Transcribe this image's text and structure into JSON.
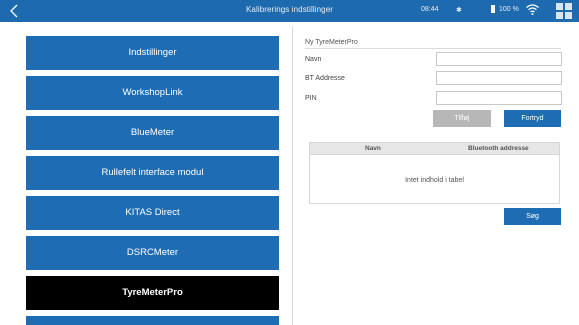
{
  "topbar": {
    "title": "Kalibrerings indstillinger",
    "time": "08:44",
    "bluetooth_symbol": "✱",
    "battery": "100 %",
    "back_icon": "chevron-left-icon",
    "wifi_icon": "wifi-icon",
    "apps_icon": "grid-icon"
  },
  "menu": {
    "items": [
      {
        "label": "Indstillinger"
      },
      {
        "label": "WorkshopLink"
      },
      {
        "label": "BlueMeter"
      },
      {
        "label": "Rullefelt interface modul"
      },
      {
        "label": "KITAS Direct"
      },
      {
        "label": "DSRCMeter"
      },
      {
        "label": "TyreMeterPro"
      }
    ],
    "active_index": 6
  },
  "form": {
    "title": "Ny TyreMeterPro",
    "fields": [
      {
        "label": "Navn",
        "value": ""
      },
      {
        "label": "BT Addresse",
        "value": ""
      },
      {
        "label": "PIN",
        "value": ""
      }
    ],
    "add_label": "Tilføj",
    "cancel_label": "Fortryd",
    "search_label": "Søg"
  },
  "table": {
    "columns": [
      "Navn",
      "Bluetooth addresse"
    ],
    "rows": [],
    "empty_text": "Intet indhold i tabel"
  },
  "colors": {
    "accent": "#1e6db4",
    "topbar": "#1d6aae",
    "active": "#000000",
    "disabled": "#b7b7b7"
  }
}
